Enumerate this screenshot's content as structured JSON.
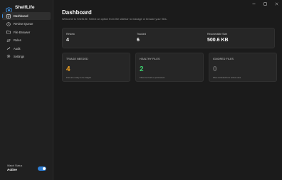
{
  "app": {
    "name": "ShelfLife"
  },
  "sidebar": {
    "items": [
      {
        "label": "Dashboard",
        "icon": "dashboard-icon",
        "active": true
      },
      {
        "label": "Review Queue",
        "icon": "clock-icon"
      },
      {
        "label": "File Browser",
        "icon": "folder-icon"
      },
      {
        "label": "Rules",
        "icon": "rules-icon"
      },
      {
        "label": "Audit",
        "icon": "audit-icon"
      },
      {
        "label": "Settings",
        "icon": "gear-icon"
      }
    ],
    "watch": {
      "label": "Watch Status",
      "value": "Active",
      "enabled": true
    }
  },
  "page": {
    "title": "Dashboard",
    "subtitle": "Welcome to ShelfLife. Select an option from the sidebar to manage or browse your files."
  },
  "stats": [
    {
      "label": "Review",
      "value": "4"
    },
    {
      "label": "Tracked",
      "value": "6"
    },
    {
      "label": "Recoverable Size",
      "value": "500.6 KB"
    }
  ],
  "cards": [
    {
      "title": "TRIAGE NEEDED",
      "value": "4",
      "desc": "Files are ready to be triaged",
      "color": "#f0a020"
    },
    {
      "title": "HEALTHY FILES",
      "value": "2",
      "desc": "Files are fresh or permanent",
      "color": "#3ccf6e"
    },
    {
      "title": "IGNORED FILES",
      "value": "0",
      "desc": "Files excluded from active rules",
      "color": "#6a6a6a"
    }
  ],
  "colors": {
    "accent": "#3a8dde",
    "background": "#1b1b1b",
    "panel": "#262626"
  }
}
